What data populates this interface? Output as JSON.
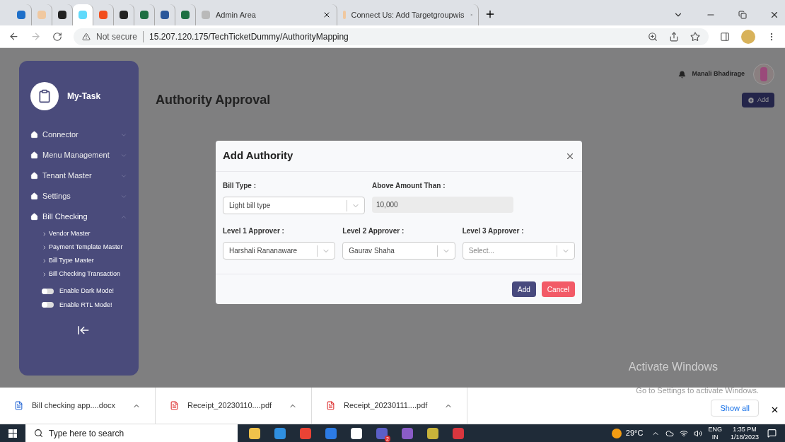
{
  "browser": {
    "tabs": [
      {
        "selected": false
      },
      {
        "selected": false
      },
      {
        "selected": false
      },
      {
        "selected": true
      },
      {
        "selected": false
      },
      {
        "selected": false
      },
      {
        "selected": false
      },
      {
        "selected": false
      },
      {
        "selected": false
      },
      {
        "label": "Admin Area",
        "selected": false
      },
      {
        "label": "Connect Us: Add Targetgroupwis",
        "selected": false
      }
    ],
    "security": "Not secure",
    "url": "15.207.120.175/TechTicketDummy/AuthorityMapping"
  },
  "sidebar": {
    "brand": "My-Task",
    "items": [
      {
        "label": "Connector",
        "expanded": false
      },
      {
        "label": "Menu Management",
        "expanded": false
      },
      {
        "label": "Tenant Master",
        "expanded": false
      },
      {
        "label": "Settings",
        "expanded": false
      },
      {
        "label": "Bill Checking",
        "expanded": true,
        "children": [
          {
            "label": "Vendor Master"
          },
          {
            "label": "Payment Template Master"
          },
          {
            "label": "Bill Type Master"
          },
          {
            "label": "Bill Checking Transaction"
          }
        ]
      }
    ],
    "toggles": [
      {
        "label": "Enable Dark Mode!",
        "on": false
      },
      {
        "label": "Enable RTL Mode!",
        "on": false
      }
    ]
  },
  "header": {
    "user": "Manali Bhadirage",
    "title": "Authority Approval",
    "add_button": "Add"
  },
  "dialog": {
    "title": "Add Authority",
    "fields": [
      {
        "label": "Bill Type :",
        "kind": "select",
        "value": "Light bill type"
      },
      {
        "label": "Above Amount Than :",
        "kind": "readonly",
        "value": "10,000"
      },
      {
        "label": "Level 1 Approver :",
        "kind": "select",
        "value": "Harshali Rananaware"
      },
      {
        "label": "Level 2 Approver :",
        "kind": "select",
        "value": "Gaurav Shaha"
      },
      {
        "label": "Level 3 Approver :",
        "kind": "select",
        "placeholder": "Select..."
      }
    ],
    "buttons": [
      {
        "label": "Add",
        "kind": "primary"
      },
      {
        "label": "Cancel",
        "kind": "danger"
      }
    ]
  },
  "activation": {
    "title": "Activate Windows",
    "hint": "Go to Settings to activate Windows."
  },
  "downloads": {
    "files": [
      {
        "name": "Bill checking app....docx",
        "kind": "doc"
      },
      {
        "name": "Receipt_20230110....pdf",
        "kind": "pdf"
      },
      {
        "name": "Receipt_20230111....pdf",
        "kind": "pdf"
      }
    ],
    "show_all": "Show all"
  },
  "taskbar": {
    "search_placeholder": "Type here to search",
    "teams_badge": "2",
    "temperature": "29°C",
    "lang_1": "ENG",
    "lang_2": "IN",
    "time": "1:35 PM",
    "date": "1/18/2023"
  }
}
